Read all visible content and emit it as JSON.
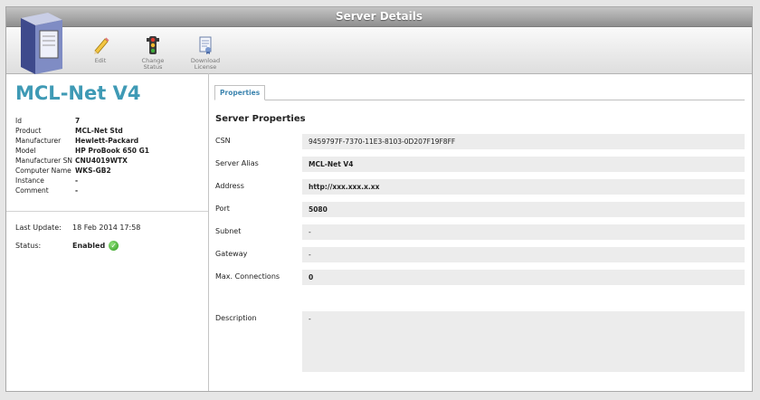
{
  "window": {
    "title": "Server Details"
  },
  "toolbar": {
    "edit_label": "Edit",
    "change_status_label_1": "Change",
    "change_status_label_2": "Status",
    "download_license_label_1": "Download",
    "download_license_label_2": "License"
  },
  "server": {
    "name": "MCL-Net V4",
    "properties": [
      {
        "label": "Id",
        "value": "7"
      },
      {
        "label": "Product",
        "value": "MCL-Net Std"
      },
      {
        "label": "Manufacturer",
        "value": "Hewlett-Packard"
      },
      {
        "label": "Model",
        "value": "HP ProBook 650 G1"
      },
      {
        "label": "Manufacturer SN",
        "value": "CNU4019WTX"
      },
      {
        "label": "Computer Name",
        "value": "WKS-GB2"
      },
      {
        "label": "Instance",
        "value": "-"
      },
      {
        "label": "Comment",
        "value": "-"
      }
    ],
    "last_update_label": "Last Update:",
    "last_update_value": "18 Feb 2014 17:58",
    "status_label": "Status:",
    "status_value": "Enabled"
  },
  "tabs": {
    "properties_label": "Properties"
  },
  "details": {
    "section_title": "Server Properties",
    "fields": [
      {
        "label": "CSN",
        "value": "9459797F-7370-11E3-8103-0D207F19F8FF"
      },
      {
        "label": "Server Alias",
        "value": "MCL-Net V4"
      },
      {
        "label": "Address",
        "value": "http://xxx.xxx.x.xx"
      },
      {
        "label": "Port",
        "value": "5080"
      },
      {
        "label": "Subnet",
        "value": "-"
      },
      {
        "label": "Gateway",
        "value": "-"
      },
      {
        "label": "Max. Connections",
        "value": "0"
      }
    ],
    "description_label": "Description",
    "description_value": "-"
  },
  "colors": {
    "title_accent": "#3f9ab5",
    "tab_text": "#3f86b0",
    "status_ok": "#2f9b1f"
  },
  "icons": {
    "server": "server-tower-icon",
    "edit": "pencil-icon",
    "change_status": "traffic-light-icon",
    "download": "license-document-icon",
    "status": "check-circle-icon"
  }
}
